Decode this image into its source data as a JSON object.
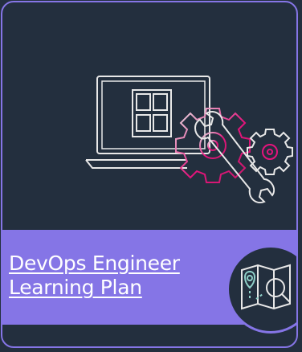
{
  "card": {
    "title_line1": "DevOps Engineer",
    "title_line2": "Learning Plan",
    "hero_icon": "laptop-with-gears-and-wrench-icon",
    "badge_icon": "map-with-location-pin-and-magnifier-icon"
  },
  "colors": {
    "background": "#232f3e",
    "accent": "#8575e6",
    "gear_pink": "#e4147c",
    "text": "#ffffff"
  }
}
